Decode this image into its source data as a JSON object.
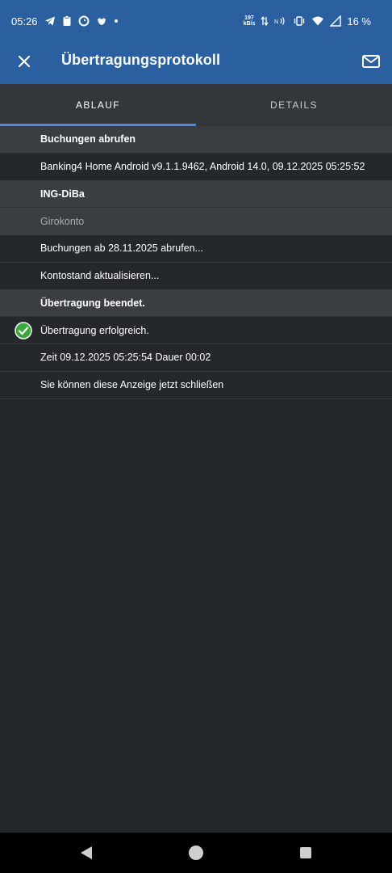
{
  "status": {
    "time": "05:26",
    "netspeed_value": "197",
    "netspeed_unit": "kB/s",
    "battery": "16 %"
  },
  "toolbar": {
    "title": "Übertragungsprotokoll"
  },
  "tabs": [
    {
      "label": "ABLAUF",
      "active": true
    },
    {
      "label": "DETAILS",
      "active": false
    }
  ],
  "log": {
    "rows": [
      {
        "text": "Buchungen abrufen"
      },
      {
        "text": "Banking4 Home Android v9.1.1.9462, Android 14.0, 09.12.2025 05:25:52"
      },
      {
        "text": "ING-DiBa"
      },
      {
        "text": "Girokonto"
      },
      {
        "text": "Buchungen ab 28.11.2025 abrufen..."
      },
      {
        "text": "Kontostand aktualisieren..."
      },
      {
        "text": "Übertragung beendet."
      },
      {
        "text": "Übertragung erfolgreich."
      },
      {
        "text": "Zeit 09.12.2025 05:25:54 Dauer 00:02"
      },
      {
        "text": "Sie können diese Anzeige jetzt schließen"
      }
    ]
  },
  "colors": {
    "appbar": "#2a5fa0",
    "tab_indicator": "#4a8be0",
    "success": "#3aa83a"
  },
  "icons": {
    "close": "close-icon",
    "mail": "mail-icon",
    "success": "check-circle-icon"
  }
}
